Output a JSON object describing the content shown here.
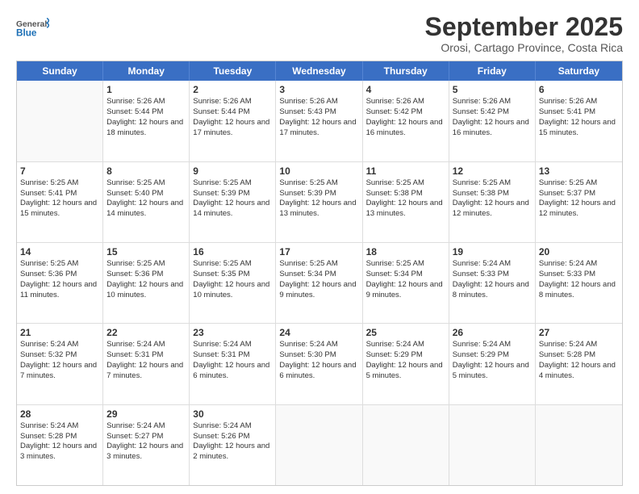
{
  "header": {
    "logo_general": "General",
    "logo_blue": "Blue",
    "month_title": "September 2025",
    "location": "Orosi, Cartago Province, Costa Rica"
  },
  "days_of_week": [
    "Sunday",
    "Monday",
    "Tuesday",
    "Wednesday",
    "Thursday",
    "Friday",
    "Saturday"
  ],
  "weeks": [
    [
      {
        "day": "",
        "sunrise": "",
        "sunset": "",
        "daylight": ""
      },
      {
        "day": "1",
        "sunrise": "Sunrise: 5:26 AM",
        "sunset": "Sunset: 5:44 PM",
        "daylight": "Daylight: 12 hours and 18 minutes."
      },
      {
        "day": "2",
        "sunrise": "Sunrise: 5:26 AM",
        "sunset": "Sunset: 5:44 PM",
        "daylight": "Daylight: 12 hours and 17 minutes."
      },
      {
        "day": "3",
        "sunrise": "Sunrise: 5:26 AM",
        "sunset": "Sunset: 5:43 PM",
        "daylight": "Daylight: 12 hours and 17 minutes."
      },
      {
        "day": "4",
        "sunrise": "Sunrise: 5:26 AM",
        "sunset": "Sunset: 5:42 PM",
        "daylight": "Daylight: 12 hours and 16 minutes."
      },
      {
        "day": "5",
        "sunrise": "Sunrise: 5:26 AM",
        "sunset": "Sunset: 5:42 PM",
        "daylight": "Daylight: 12 hours and 16 minutes."
      },
      {
        "day": "6",
        "sunrise": "Sunrise: 5:26 AM",
        "sunset": "Sunset: 5:41 PM",
        "daylight": "Daylight: 12 hours and 15 minutes."
      }
    ],
    [
      {
        "day": "7",
        "sunrise": "Sunrise: 5:25 AM",
        "sunset": "Sunset: 5:41 PM",
        "daylight": "Daylight: 12 hours and 15 minutes."
      },
      {
        "day": "8",
        "sunrise": "Sunrise: 5:25 AM",
        "sunset": "Sunset: 5:40 PM",
        "daylight": "Daylight: 12 hours and 14 minutes."
      },
      {
        "day": "9",
        "sunrise": "Sunrise: 5:25 AM",
        "sunset": "Sunset: 5:39 PM",
        "daylight": "Daylight: 12 hours and 14 minutes."
      },
      {
        "day": "10",
        "sunrise": "Sunrise: 5:25 AM",
        "sunset": "Sunset: 5:39 PM",
        "daylight": "Daylight: 12 hours and 13 minutes."
      },
      {
        "day": "11",
        "sunrise": "Sunrise: 5:25 AM",
        "sunset": "Sunset: 5:38 PM",
        "daylight": "Daylight: 12 hours and 13 minutes."
      },
      {
        "day": "12",
        "sunrise": "Sunrise: 5:25 AM",
        "sunset": "Sunset: 5:38 PM",
        "daylight": "Daylight: 12 hours and 12 minutes."
      },
      {
        "day": "13",
        "sunrise": "Sunrise: 5:25 AM",
        "sunset": "Sunset: 5:37 PM",
        "daylight": "Daylight: 12 hours and 12 minutes."
      }
    ],
    [
      {
        "day": "14",
        "sunrise": "Sunrise: 5:25 AM",
        "sunset": "Sunset: 5:36 PM",
        "daylight": "Daylight: 12 hours and 11 minutes."
      },
      {
        "day": "15",
        "sunrise": "Sunrise: 5:25 AM",
        "sunset": "Sunset: 5:36 PM",
        "daylight": "Daylight: 12 hours and 10 minutes."
      },
      {
        "day": "16",
        "sunrise": "Sunrise: 5:25 AM",
        "sunset": "Sunset: 5:35 PM",
        "daylight": "Daylight: 12 hours and 10 minutes."
      },
      {
        "day": "17",
        "sunrise": "Sunrise: 5:25 AM",
        "sunset": "Sunset: 5:34 PM",
        "daylight": "Daylight: 12 hours and 9 minutes."
      },
      {
        "day": "18",
        "sunrise": "Sunrise: 5:25 AM",
        "sunset": "Sunset: 5:34 PM",
        "daylight": "Daylight: 12 hours and 9 minutes."
      },
      {
        "day": "19",
        "sunrise": "Sunrise: 5:24 AM",
        "sunset": "Sunset: 5:33 PM",
        "daylight": "Daylight: 12 hours and 8 minutes."
      },
      {
        "day": "20",
        "sunrise": "Sunrise: 5:24 AM",
        "sunset": "Sunset: 5:33 PM",
        "daylight": "Daylight: 12 hours and 8 minutes."
      }
    ],
    [
      {
        "day": "21",
        "sunrise": "Sunrise: 5:24 AM",
        "sunset": "Sunset: 5:32 PM",
        "daylight": "Daylight: 12 hours and 7 minutes."
      },
      {
        "day": "22",
        "sunrise": "Sunrise: 5:24 AM",
        "sunset": "Sunset: 5:31 PM",
        "daylight": "Daylight: 12 hours and 7 minutes."
      },
      {
        "day": "23",
        "sunrise": "Sunrise: 5:24 AM",
        "sunset": "Sunset: 5:31 PM",
        "daylight": "Daylight: 12 hours and 6 minutes."
      },
      {
        "day": "24",
        "sunrise": "Sunrise: 5:24 AM",
        "sunset": "Sunset: 5:30 PM",
        "daylight": "Daylight: 12 hours and 6 minutes."
      },
      {
        "day": "25",
        "sunrise": "Sunrise: 5:24 AM",
        "sunset": "Sunset: 5:29 PM",
        "daylight": "Daylight: 12 hours and 5 minutes."
      },
      {
        "day": "26",
        "sunrise": "Sunrise: 5:24 AM",
        "sunset": "Sunset: 5:29 PM",
        "daylight": "Daylight: 12 hours and 5 minutes."
      },
      {
        "day": "27",
        "sunrise": "Sunrise: 5:24 AM",
        "sunset": "Sunset: 5:28 PM",
        "daylight": "Daylight: 12 hours and 4 minutes."
      }
    ],
    [
      {
        "day": "28",
        "sunrise": "Sunrise: 5:24 AM",
        "sunset": "Sunset: 5:28 PM",
        "daylight": "Daylight: 12 hours and 3 minutes."
      },
      {
        "day": "29",
        "sunrise": "Sunrise: 5:24 AM",
        "sunset": "Sunset: 5:27 PM",
        "daylight": "Daylight: 12 hours and 3 minutes."
      },
      {
        "day": "30",
        "sunrise": "Sunrise: 5:24 AM",
        "sunset": "Sunset: 5:26 PM",
        "daylight": "Daylight: 12 hours and 2 minutes."
      },
      {
        "day": "",
        "sunrise": "",
        "sunset": "",
        "daylight": ""
      },
      {
        "day": "",
        "sunrise": "",
        "sunset": "",
        "daylight": ""
      },
      {
        "day": "",
        "sunrise": "",
        "sunset": "",
        "daylight": ""
      },
      {
        "day": "",
        "sunrise": "",
        "sunset": "",
        "daylight": ""
      }
    ]
  ]
}
